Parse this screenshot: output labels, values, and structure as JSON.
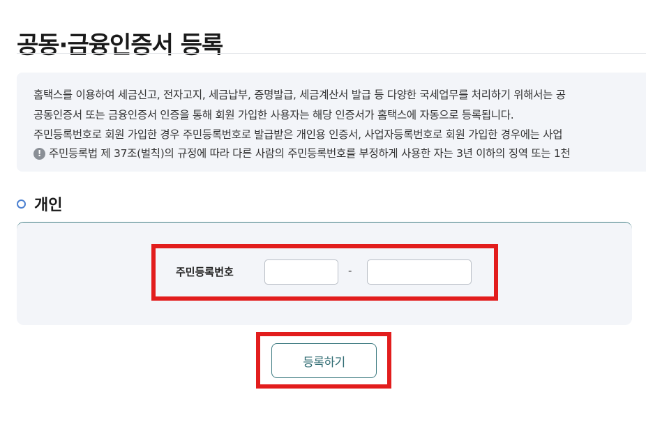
{
  "page": {
    "title": "공동·금융인증서 등록"
  },
  "info": {
    "line1": "홈택스를 이용하여 세금신고, 전자고지, 세금납부, 증명발급, 세금계산서 발급 등 다양한 국세업무를 처리하기 위해서는 공",
    "line2": "공동인증서 또는 금융인증서 인증을 통해 회원 가입한 사용자는 해당 인증서가 홈택스에 자동으로 등록됩니다.",
    "line3": "주민등록번호로 회원 가입한 경우 주민등록번호로 발급받은 개인용 인증서, 사업자등록번호로 회원 가입한 경우에는 사업",
    "warning_icon": "!",
    "line4": "주민등록법 제 37조(벌칙)의 규정에 따라 다른 사람의 주민등록번호를 부정하게 사용한 자는 3년 이하의 징역 또는 1천"
  },
  "section": {
    "title": "개인"
  },
  "form": {
    "rrn_label": "주민등록번호",
    "rrn_front_value": "",
    "rrn_back_value": "",
    "separator": "-"
  },
  "actions": {
    "register_label": "등록하기"
  },
  "colors": {
    "accent": "#3c7a80",
    "highlight": "#e21d1d",
    "bullet": "#4a7fd0",
    "panel_bg": "#f3f5f9"
  }
}
